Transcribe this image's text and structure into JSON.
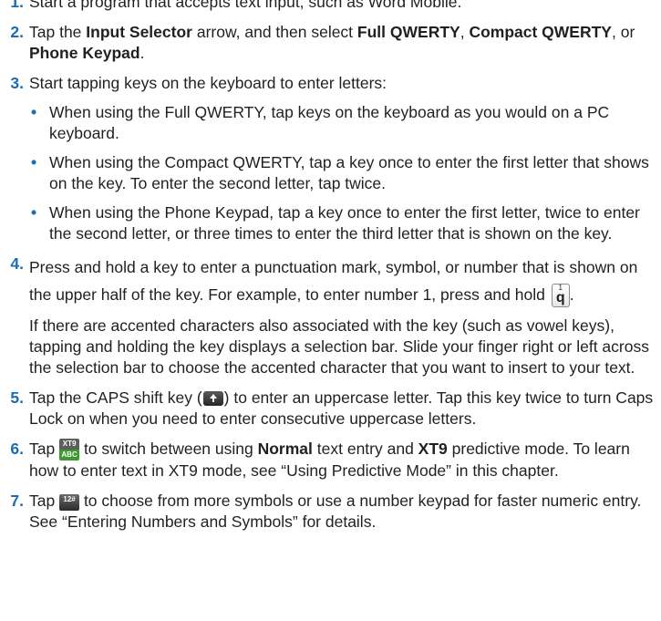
{
  "steps": [
    {
      "num": "1.",
      "text": "Start a program that accepts text input, such as Word Mobile."
    },
    {
      "num": "2.",
      "pre": "Tap the ",
      "b1": "Input Selector",
      "mid1": " arrow, and then select ",
      "b2": "Full QWERTY",
      "mid2": ", ",
      "b3": "Compact QWERTY",
      "mid3": ", or ",
      "b4": "Phone Keypad",
      "post": "."
    },
    {
      "num": "3.",
      "text": "Start tapping keys on the keyboard to enter letters:",
      "bullets": [
        "When using the Full QWERTY, tap keys on the keyboard as you would on a PC keyboard.",
        "When using the Compact QWERTY, tap a key once to enter the first letter that shows on the key. To enter the second letter, tap twice.",
        "When using the Phone Keypad, tap a key once to enter the first letter, twice to enter the second letter, or three times to enter the third letter that is shown on the key."
      ]
    },
    {
      "num": "4.",
      "text": "Press and hold a key to enter a punctuation mark, symbol, or number that is shown on the upper half of the key. For example, to enter number 1, press and hold",
      "key_sup": "1",
      "key_main": "q",
      "key_post": ".",
      "cont": "If there are accented characters also associated with the key (such as vowel keys), tapping and holding the key displays a selection bar. Slide your finger right or left across the selection bar to choose the accented character that you want to insert to your text."
    },
    {
      "num": "5.",
      "pre": "Tap the CAPS shift key (",
      "post": ") to enter an uppercase letter. Tap this key twice to turn Caps Lock on when you need to enter consecutive uppercase letters."
    },
    {
      "num": "6.",
      "pre": "Tap ",
      "icon_top": "XT9",
      "icon_bottom": "ABC",
      "mid1": " to switch between using ",
      "b1": "Normal",
      "mid2": " text entry and ",
      "b2": "XT9",
      "post": " predictive mode. To learn how to enter text in XT9 mode, see “Using Predictive Mode” in this chapter."
    },
    {
      "num": "7.",
      "pre": "Tap ",
      "icon": "12#",
      "post": " to choose from more symbols or use a number keypad for faster numeric entry. See “Entering Numbers and Symbols” for details."
    }
  ],
  "colors": {
    "accent": "#1b6cb0",
    "text": "#231f20"
  },
  "icons": {
    "bullet": "•"
  }
}
